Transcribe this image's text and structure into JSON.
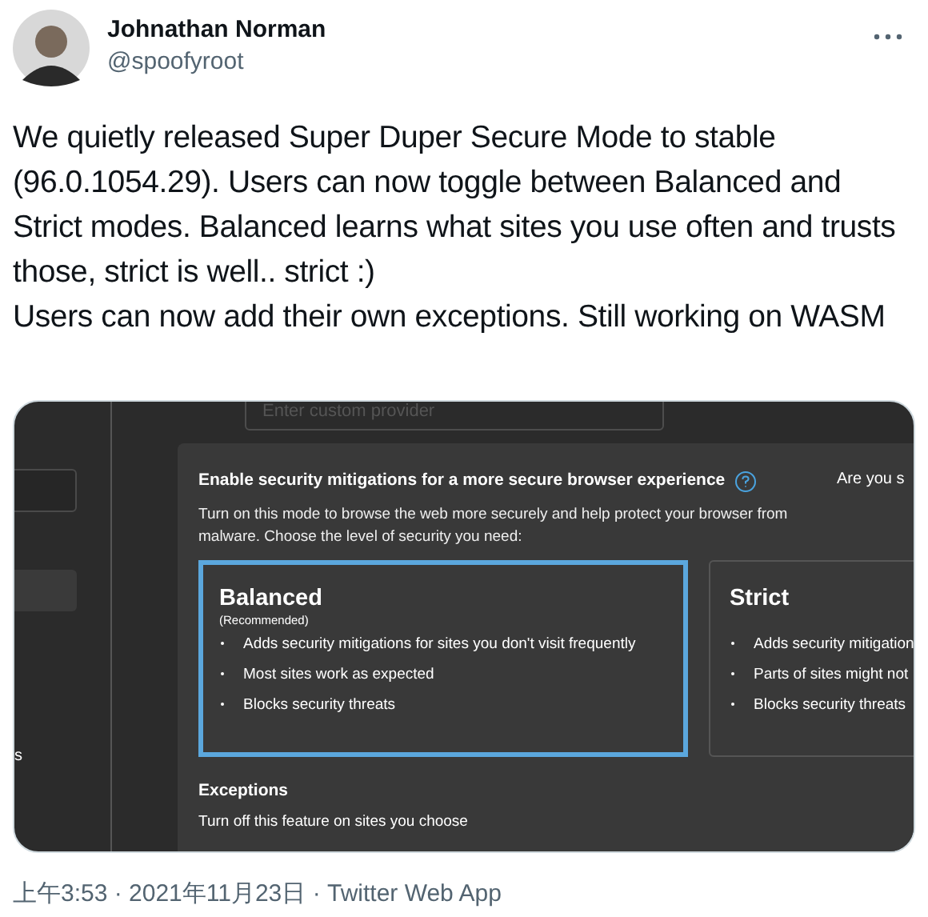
{
  "author": {
    "name": "Johnathan Norman",
    "handle": "@spoofyroot"
  },
  "tweet_text": [
    "We quietly released Super Duper Secure Mode to stable (96.0.1054.29). Users can now toggle between Balanced and Strict modes. Balanced learns what sites you use often and trusts those, strict is well.. strict :)",
    "Users can now add their own exceptions.  Still working on WASM"
  ],
  "screenshot": {
    "provider_field": {
      "placeholder": "Enter custom provider"
    },
    "sidebar_text": "s",
    "heading": "Enable security mitigations for a more secure browser experience",
    "side_text": "Are you s",
    "description": "Turn on this mode to browse the web more securely and help protect your browser from malware. Choose the level of security you need:",
    "modes": [
      {
        "title": "Balanced",
        "subtitle": "(Recommended)",
        "selected": true,
        "bullets": [
          "Adds security mitigations for sites you don't visit frequently",
          "Most sites work as expected",
          "Blocks security threats"
        ]
      },
      {
        "title": "Strict",
        "selected": false,
        "bullets": [
          "Adds security mitigation",
          "Parts of sites might not",
          "Blocks security threats"
        ]
      }
    ],
    "exceptions": {
      "title": "Exceptions",
      "description": "Turn off this feature on sites you choose"
    }
  },
  "footer": "上午3:53 · 2021年11月23日 · Twitter Web App"
}
